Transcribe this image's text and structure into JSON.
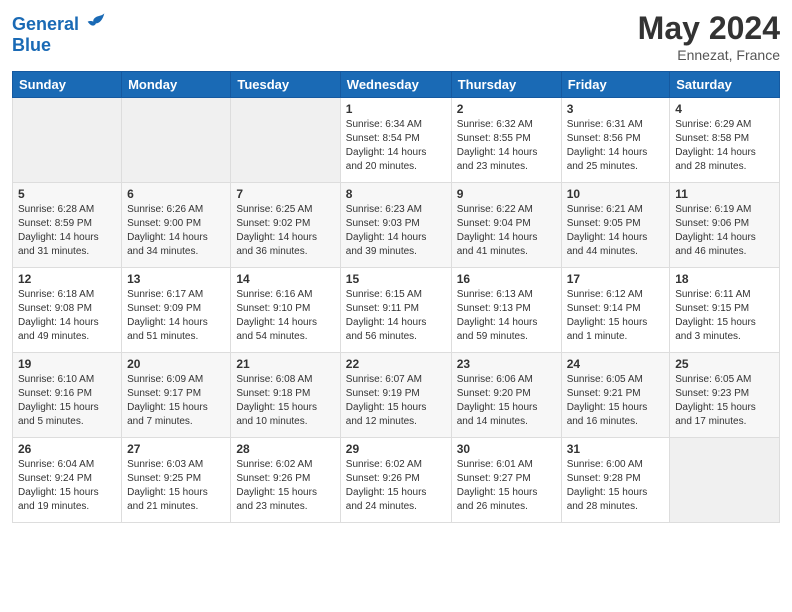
{
  "logo": {
    "line1": "General",
    "line2": "Blue"
  },
  "title": "May 2024",
  "location": "Ennezat, France",
  "days_header": [
    "Sunday",
    "Monday",
    "Tuesday",
    "Wednesday",
    "Thursday",
    "Friday",
    "Saturday"
  ],
  "weeks": [
    [
      {
        "day": "",
        "sunrise": "",
        "sunset": "",
        "daylight": ""
      },
      {
        "day": "",
        "sunrise": "",
        "sunset": "",
        "daylight": ""
      },
      {
        "day": "",
        "sunrise": "",
        "sunset": "",
        "daylight": ""
      },
      {
        "day": "1",
        "sunrise": "Sunrise: 6:34 AM",
        "sunset": "Sunset: 8:54 PM",
        "daylight": "Daylight: 14 hours and 20 minutes."
      },
      {
        "day": "2",
        "sunrise": "Sunrise: 6:32 AM",
        "sunset": "Sunset: 8:55 PM",
        "daylight": "Daylight: 14 hours and 23 minutes."
      },
      {
        "day": "3",
        "sunrise": "Sunrise: 6:31 AM",
        "sunset": "Sunset: 8:56 PM",
        "daylight": "Daylight: 14 hours and 25 minutes."
      },
      {
        "day": "4",
        "sunrise": "Sunrise: 6:29 AM",
        "sunset": "Sunset: 8:58 PM",
        "daylight": "Daylight: 14 hours and 28 minutes."
      }
    ],
    [
      {
        "day": "5",
        "sunrise": "Sunrise: 6:28 AM",
        "sunset": "Sunset: 8:59 PM",
        "daylight": "Daylight: 14 hours and 31 minutes."
      },
      {
        "day": "6",
        "sunrise": "Sunrise: 6:26 AM",
        "sunset": "Sunset: 9:00 PM",
        "daylight": "Daylight: 14 hours and 34 minutes."
      },
      {
        "day": "7",
        "sunrise": "Sunrise: 6:25 AM",
        "sunset": "Sunset: 9:02 PM",
        "daylight": "Daylight: 14 hours and 36 minutes."
      },
      {
        "day": "8",
        "sunrise": "Sunrise: 6:23 AM",
        "sunset": "Sunset: 9:03 PM",
        "daylight": "Daylight: 14 hours and 39 minutes."
      },
      {
        "day": "9",
        "sunrise": "Sunrise: 6:22 AM",
        "sunset": "Sunset: 9:04 PM",
        "daylight": "Daylight: 14 hours and 41 minutes."
      },
      {
        "day": "10",
        "sunrise": "Sunrise: 6:21 AM",
        "sunset": "Sunset: 9:05 PM",
        "daylight": "Daylight: 14 hours and 44 minutes."
      },
      {
        "day": "11",
        "sunrise": "Sunrise: 6:19 AM",
        "sunset": "Sunset: 9:06 PM",
        "daylight": "Daylight: 14 hours and 46 minutes."
      }
    ],
    [
      {
        "day": "12",
        "sunrise": "Sunrise: 6:18 AM",
        "sunset": "Sunset: 9:08 PM",
        "daylight": "Daylight: 14 hours and 49 minutes."
      },
      {
        "day": "13",
        "sunrise": "Sunrise: 6:17 AM",
        "sunset": "Sunset: 9:09 PM",
        "daylight": "Daylight: 14 hours and 51 minutes."
      },
      {
        "day": "14",
        "sunrise": "Sunrise: 6:16 AM",
        "sunset": "Sunset: 9:10 PM",
        "daylight": "Daylight: 14 hours and 54 minutes."
      },
      {
        "day": "15",
        "sunrise": "Sunrise: 6:15 AM",
        "sunset": "Sunset: 9:11 PM",
        "daylight": "Daylight: 14 hours and 56 minutes."
      },
      {
        "day": "16",
        "sunrise": "Sunrise: 6:13 AM",
        "sunset": "Sunset: 9:13 PM",
        "daylight": "Daylight: 14 hours and 59 minutes."
      },
      {
        "day": "17",
        "sunrise": "Sunrise: 6:12 AM",
        "sunset": "Sunset: 9:14 PM",
        "daylight": "Daylight: 15 hours and 1 minute."
      },
      {
        "day": "18",
        "sunrise": "Sunrise: 6:11 AM",
        "sunset": "Sunset: 9:15 PM",
        "daylight": "Daylight: 15 hours and 3 minutes."
      }
    ],
    [
      {
        "day": "19",
        "sunrise": "Sunrise: 6:10 AM",
        "sunset": "Sunset: 9:16 PM",
        "daylight": "Daylight: 15 hours and 5 minutes."
      },
      {
        "day": "20",
        "sunrise": "Sunrise: 6:09 AM",
        "sunset": "Sunset: 9:17 PM",
        "daylight": "Daylight: 15 hours and 7 minutes."
      },
      {
        "day": "21",
        "sunrise": "Sunrise: 6:08 AM",
        "sunset": "Sunset: 9:18 PM",
        "daylight": "Daylight: 15 hours and 10 minutes."
      },
      {
        "day": "22",
        "sunrise": "Sunrise: 6:07 AM",
        "sunset": "Sunset: 9:19 PM",
        "daylight": "Daylight: 15 hours and 12 minutes."
      },
      {
        "day": "23",
        "sunrise": "Sunrise: 6:06 AM",
        "sunset": "Sunset: 9:20 PM",
        "daylight": "Daylight: 15 hours and 14 minutes."
      },
      {
        "day": "24",
        "sunrise": "Sunrise: 6:05 AM",
        "sunset": "Sunset: 9:21 PM",
        "daylight": "Daylight: 15 hours and 16 minutes."
      },
      {
        "day": "25",
        "sunrise": "Sunrise: 6:05 AM",
        "sunset": "Sunset: 9:23 PM",
        "daylight": "Daylight: 15 hours and 17 minutes."
      }
    ],
    [
      {
        "day": "26",
        "sunrise": "Sunrise: 6:04 AM",
        "sunset": "Sunset: 9:24 PM",
        "daylight": "Daylight: 15 hours and 19 minutes."
      },
      {
        "day": "27",
        "sunrise": "Sunrise: 6:03 AM",
        "sunset": "Sunset: 9:25 PM",
        "daylight": "Daylight: 15 hours and 21 minutes."
      },
      {
        "day": "28",
        "sunrise": "Sunrise: 6:02 AM",
        "sunset": "Sunset: 9:26 PM",
        "daylight": "Daylight: 15 hours and 23 minutes."
      },
      {
        "day": "29",
        "sunrise": "Sunrise: 6:02 AM",
        "sunset": "Sunset: 9:26 PM",
        "daylight": "Daylight: 15 hours and 24 minutes."
      },
      {
        "day": "30",
        "sunrise": "Sunrise: 6:01 AM",
        "sunset": "Sunset: 9:27 PM",
        "daylight": "Daylight: 15 hours and 26 minutes."
      },
      {
        "day": "31",
        "sunrise": "Sunrise: 6:00 AM",
        "sunset": "Sunset: 9:28 PM",
        "daylight": "Daylight: 15 hours and 28 minutes."
      },
      {
        "day": "",
        "sunrise": "",
        "sunset": "",
        "daylight": ""
      }
    ]
  ]
}
